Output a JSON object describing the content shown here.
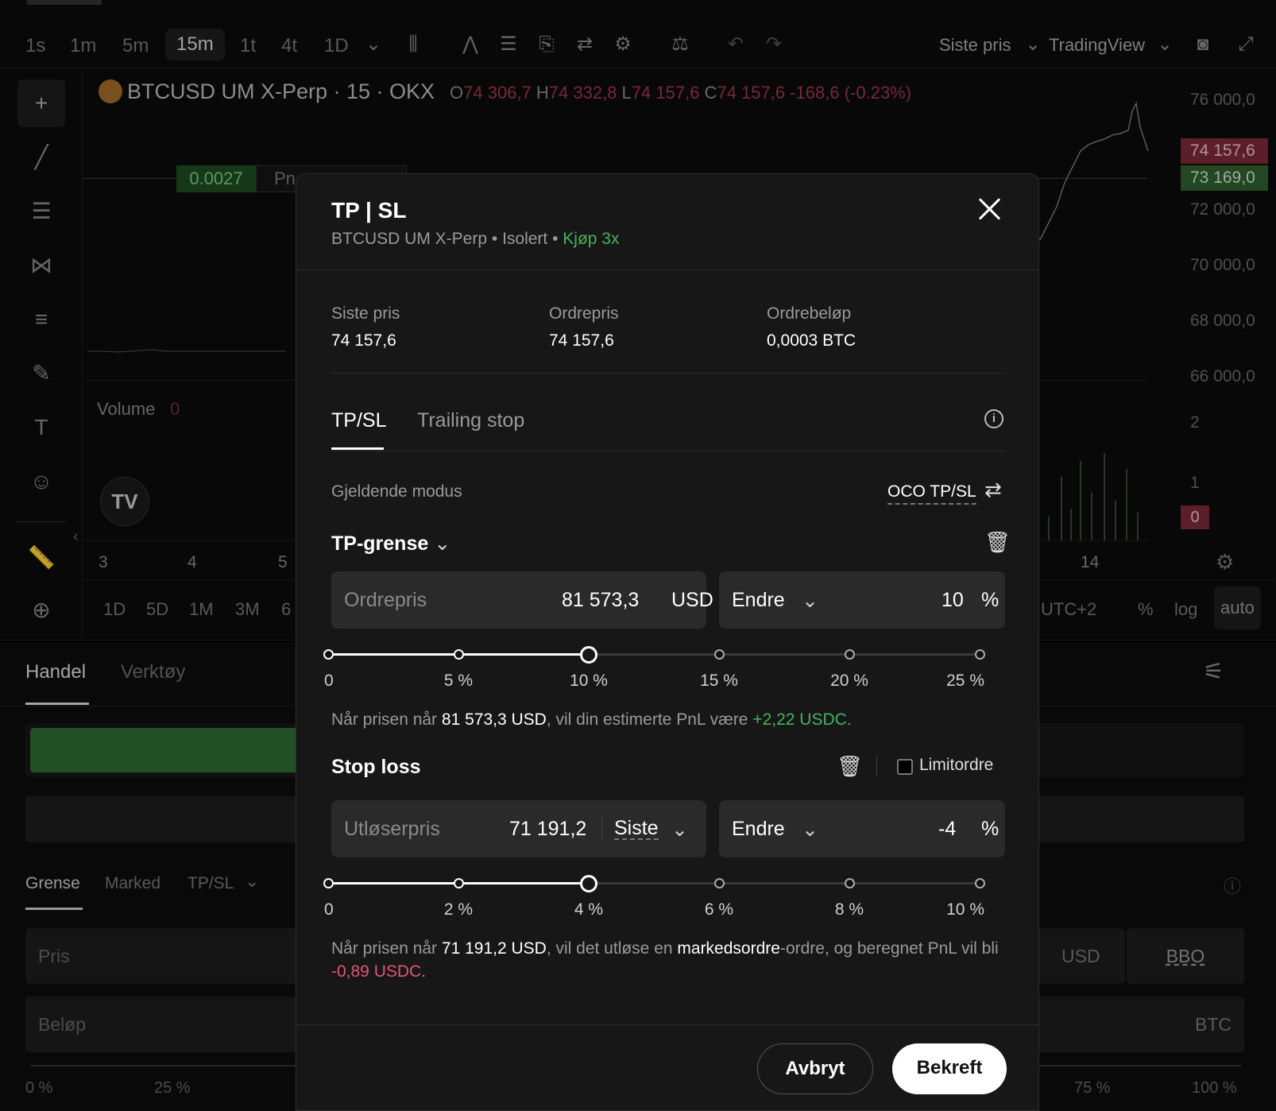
{
  "toolbar": {
    "timeframes": [
      "1s",
      "1m",
      "5m",
      "15m",
      "1t",
      "4t",
      "1D"
    ],
    "price_source": "Siste pris",
    "chart_provider": "TradingView"
  },
  "chart": {
    "symbol": "BTCUSD UM X-Perp · 15 · OKX",
    "o_label": "O",
    "o_val": "74 306,7",
    "h_label": "H",
    "h_val": "74 332,8",
    "l_label": "L",
    "l_val": "74 157,6",
    "c_label": "C",
    "c_val": "74 157,6",
    "change": "-168,6 (-0.23%)",
    "position_qty": "0.0027",
    "position_pnl": "Pn",
    "volume_label": "Volume",
    "volume_val": "0",
    "price_ticks": [
      "76 000,0",
      "72 000,0",
      "70 000,0",
      "68 000,0",
      "66 000,0"
    ],
    "last_price_tag": "74 157,6",
    "entry_price_tag": "73 169,0",
    "vol_ticks": [
      "2",
      "1"
    ],
    "vol_tag": "0",
    "x_ticks": [
      "3",
      "4",
      "5",
      "14"
    ],
    "ranges": [
      "1D",
      "5D",
      "1M",
      "3M",
      "6"
    ],
    "timezone": "UTC+2",
    "scale_opts": [
      "%",
      "log",
      "auto"
    ]
  },
  "bottom": {
    "tabs": [
      "Handel",
      "Verktøy"
    ],
    "order_types": [
      "Grense",
      "Marked",
      "TP/SL"
    ],
    "price_placeholder": "Pris",
    "qty_label": "Beløp",
    "usd_unit": "USD",
    "btc_unit": "BTC",
    "bbo": "BBO",
    "slider_left": [
      "0 %",
      "25 %"
    ],
    "slider_right": [
      "75 %",
      "100 %"
    ]
  },
  "modal": {
    "title": "TP | SL",
    "subtitle_symbol": "BTCUSD UM X-Perp",
    "subtitle_margin": "Isolert",
    "subtitle_side": "Kjøp 3x",
    "last_price_label": "Siste pris",
    "last_price": "74 157,6",
    "order_price_label": "Ordrepris",
    "order_price": "74 157,6",
    "order_amount_label": "Ordrebeløp",
    "order_amount": "0,0003 BTC",
    "tabs": [
      "TP/SL",
      "Trailing stop"
    ],
    "mode_label": "Gjeldende modus",
    "mode_value": "OCO TP/SL",
    "tp": {
      "title": "TP-grense",
      "price_label": "Ordrepris",
      "price": "81 573,3",
      "unit": "USD",
      "change_label": "Endre",
      "change": "10",
      "pct": "%",
      "percent": 10,
      "slider_labels": [
        "0",
        "5 %",
        "10 %",
        "15 %",
        "20 %",
        "25 %"
      ],
      "note_prefix": "Når prisen når ",
      "note_price": "81 573,3 USD",
      "note_mid": ", vil din estimerte PnL være ",
      "note_pnl": "+2,22 USDC."
    },
    "sl": {
      "title": "Stop loss",
      "limit_label": "Limitordre",
      "price_label": "Utløserpris",
      "price": "71 191,2",
      "trigger": "Siste",
      "change_label": "Endre",
      "change": "-4",
      "pct": "%",
      "percent": 4,
      "slider_labels": [
        "0",
        "2 %",
        "4 %",
        "6 %",
        "8 %",
        "10 %"
      ],
      "note_prefix": "Når prisen når ",
      "note_price": "71 191,2 USD",
      "note_mid": ", vil det utløse en ",
      "note_type": "markedsordre",
      "note_mid2": "-ordre, og beregnet PnL vil bli ",
      "note_pnl": "-0,89 USDC",
      "note_end": "."
    },
    "cancel": "Avbryt",
    "confirm": "Bekreft"
  },
  "colors": {
    "green": "#44b35c",
    "red": "#e0557a",
    "accent_bg": "#2a2a2a"
  }
}
